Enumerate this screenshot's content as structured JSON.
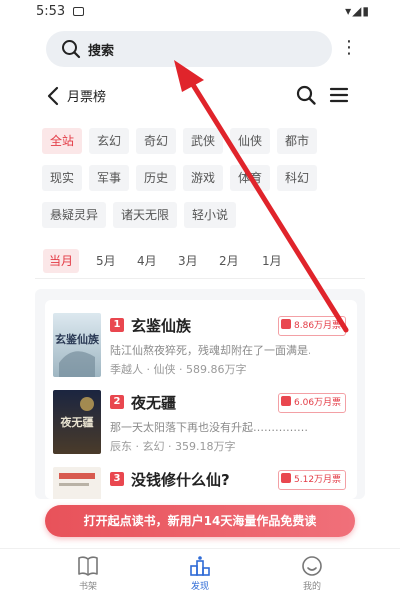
{
  "status_bar": {
    "time": "5:53",
    "icons": "▾◢▮"
  },
  "search": {
    "label": "搜索",
    "more": "⋮"
  },
  "header": {
    "back": "‹",
    "title": "月票榜"
  },
  "categories": [
    "全站",
    "玄幻",
    "奇幻",
    "武侠",
    "仙侠",
    "都市",
    "现实",
    "军事",
    "历史",
    "游戏",
    "体育",
    "科幻",
    "悬疑灵异",
    "诸天无限",
    "轻小说"
  ],
  "active_category": "全站",
  "months": [
    "当月",
    "5月",
    "4月",
    "3月",
    "2月",
    "1月"
  ],
  "active_month": "当月",
  "books": [
    {
      "rank": "1",
      "title": "玄鉴仙族",
      "desc": "陆江仙熬夜猝死，残魂却附在了一面满是…",
      "meta": "季越人 · 仙侠 · 589.86万字",
      "votes": "8.86万月票",
      "cover_text": "玄鉴仙族"
    },
    {
      "rank": "2",
      "title": "夜无疆",
      "desc": "那一天太阳落下再也没有升起……………",
      "meta": "辰东 · 玄幻 · 359.18万字",
      "votes": "6.06万月票",
      "cover_text": "夜无疆"
    },
    {
      "rank": "3",
      "title": "没钱修什么仙?",
      "desc": "",
      "meta": "",
      "votes": "5.12万月票",
      "cover_text": ""
    }
  ],
  "banner": {
    "text": "打开起点读书，新用户14天海量作品免费读"
  },
  "nav": [
    {
      "label": "书架",
      "icon": "book-icon"
    },
    {
      "label": "发现",
      "icon": "discover-icon"
    },
    {
      "label": "我的",
      "icon": "profile-icon"
    }
  ],
  "colors": {
    "accent": "#e33b45",
    "nav_active": "#2f6bd6",
    "arrow": "#e0242b"
  }
}
